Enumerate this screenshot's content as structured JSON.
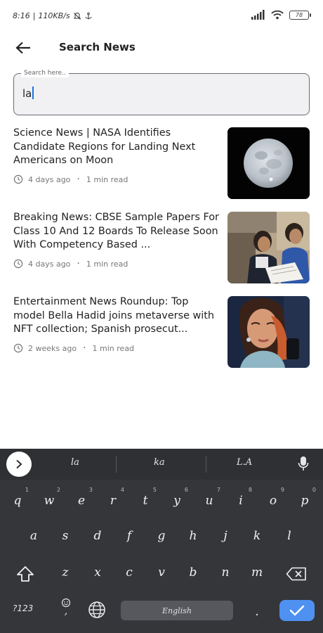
{
  "status_bar": {
    "time": "8:16",
    "speed": "110KB/s",
    "battery": "78"
  },
  "header": {
    "title": "Search News"
  },
  "search": {
    "label": "Search here..",
    "value": "la"
  },
  "news": [
    {
      "title": "Science News | NASA Identifies Candidate Regions for Landing Next Americans on Moon",
      "time": "4 days ago",
      "read": "1 min read"
    },
    {
      "title": "Breaking News: CBSE Sample Papers For Class 10 And 12 Boards To Release Soon With Competency Based ...",
      "time": "4 days ago",
      "read": "1 min read"
    },
    {
      "title": "Entertainment News Roundup: Top model Bella Hadid joins metaverse with NFT collection; Spanish prosecut...",
      "time": "2 weeks ago",
      "read": "1 min read"
    }
  ],
  "keyboard": {
    "suggestions": [
      "la",
      "ka",
      "L.A"
    ],
    "row1": [
      "q",
      "w",
      "e",
      "r",
      "t",
      "y",
      "u",
      "i",
      "o",
      "p"
    ],
    "row1_hints": [
      "1",
      "2",
      "3",
      "4",
      "5",
      "6",
      "7",
      "8",
      "9",
      "0"
    ],
    "row2": [
      "a",
      "s",
      "d",
      "f",
      "g",
      "h",
      "j",
      "k",
      "l"
    ],
    "row3": [
      "z",
      "x",
      "c",
      "v",
      "b",
      "n",
      "m"
    ],
    "symbols_label": "?123",
    "comma": ",",
    "period": ".",
    "space_label": "English",
    "accent_color": "#4f91f0"
  }
}
